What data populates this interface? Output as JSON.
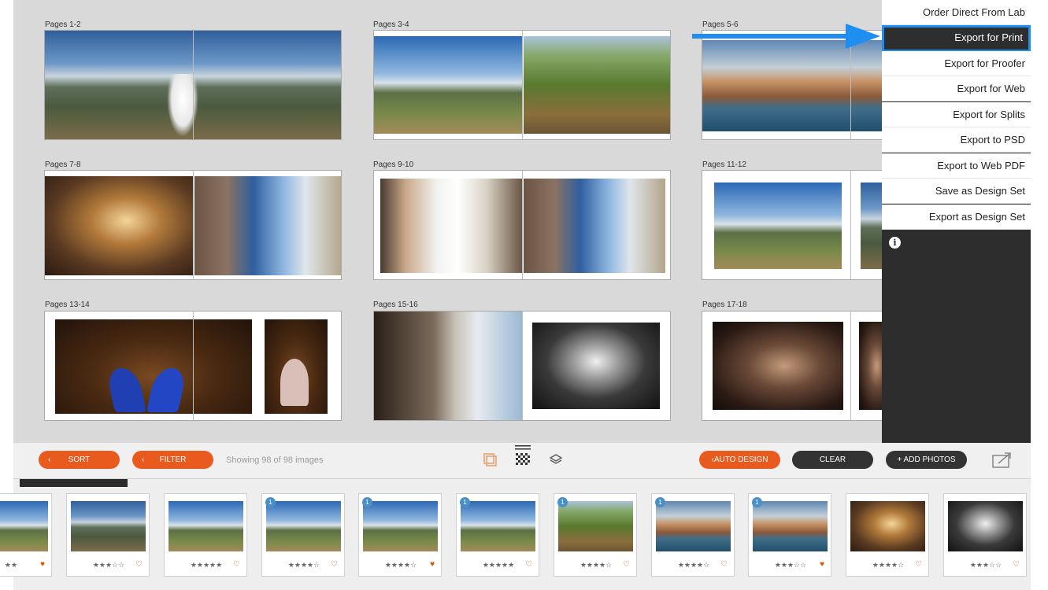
{
  "spreads": [
    {
      "label": "Pages 1-2"
    },
    {
      "label": "Pages 3-4"
    },
    {
      "label": "Pages 5-6"
    },
    {
      "label": "Pages 7-8"
    },
    {
      "label": "Pages 9-10"
    },
    {
      "label": "Pages 11-12"
    },
    {
      "label": "Pages 13-14"
    },
    {
      "label": "Pages 15-16"
    },
    {
      "label": "Pages 17-18"
    }
  ],
  "export_menu": {
    "items": [
      {
        "label": "Order Direct From Lab"
      },
      {
        "label": "Export for Print",
        "selected": true
      },
      {
        "label": "Export for Proofer"
      },
      {
        "label": "Export for Web"
      },
      {
        "label": "Export for Splits"
      },
      {
        "label": "Export to PSD"
      },
      {
        "label": "Export to Web PDF"
      },
      {
        "label": "Save as Design Set"
      },
      {
        "label": "Export as Design Set"
      }
    ],
    "info_icon": "i"
  },
  "toolbar": {
    "sort_label": "SORT",
    "filter_label": "FILTER",
    "showing_text": "Showing 98 of 98 images",
    "auto_design_label": "AUTO DESIGN",
    "clear_label": "CLEAR",
    "add_photos_label": "+ ADD PHOTOS",
    "accent_color": "#e85a1e"
  },
  "filmstrip": {
    "thumbnails": [
      {
        "badge": "",
        "stars": "★★",
        "favorite": true
      },
      {
        "badge": "",
        "stars": "★★★☆☆",
        "favorite": false
      },
      {
        "badge": "",
        "stars": "★★★★★",
        "favorite": false
      },
      {
        "badge": "1",
        "stars": "★★★★☆",
        "favorite": false
      },
      {
        "badge": "1",
        "stars": "★★★★☆",
        "favorite": true
      },
      {
        "badge": "1",
        "stars": "★★★★★",
        "favorite": false
      },
      {
        "badge": "1",
        "stars": "★★★★☆",
        "favorite": false
      },
      {
        "badge": "1",
        "stars": "★★★★☆",
        "favorite": false
      },
      {
        "badge": "1",
        "stars": "★★★☆☆",
        "favorite": true
      },
      {
        "badge": "",
        "stars": "★★★★☆",
        "favorite": false
      },
      {
        "badge": "",
        "stars": "★★★☆☆",
        "favorite": false
      }
    ],
    "heart_filled": "♥",
    "heart_empty": "♡"
  }
}
